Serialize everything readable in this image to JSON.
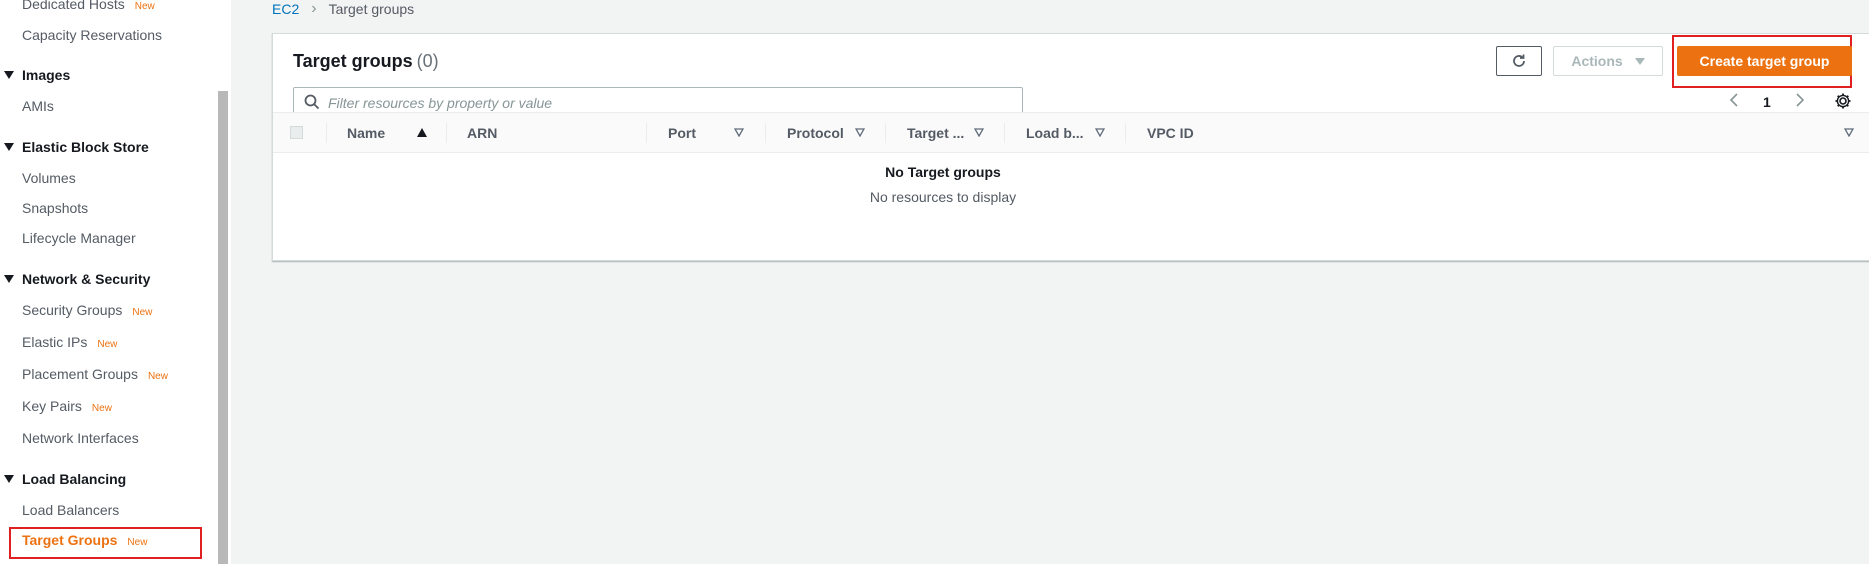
{
  "sidebar": {
    "items_top": [
      {
        "label": "Dedicated Hosts",
        "badge": "New"
      },
      {
        "label": "Capacity Reservations",
        "badge": ""
      }
    ],
    "sections": [
      {
        "title": "Images",
        "items": [
          {
            "label": "AMIs",
            "badge": ""
          }
        ]
      },
      {
        "title": "Elastic Block Store",
        "items": [
          {
            "label": "Volumes",
            "badge": ""
          },
          {
            "label": "Snapshots",
            "badge": ""
          },
          {
            "label": "Lifecycle Manager",
            "badge": ""
          }
        ]
      },
      {
        "title": "Network & Security",
        "items": [
          {
            "label": "Security Groups",
            "badge": "New"
          },
          {
            "label": "Elastic IPs",
            "badge": "New"
          },
          {
            "label": "Placement Groups",
            "badge": "New"
          },
          {
            "label": "Key Pairs",
            "badge": "New"
          },
          {
            "label": "Network Interfaces",
            "badge": ""
          }
        ]
      },
      {
        "title": "Load Balancing",
        "items": [
          {
            "label": "Load Balancers",
            "badge": ""
          },
          {
            "label": "Target Groups",
            "badge": "New"
          }
        ]
      }
    ]
  },
  "breadcrumb": {
    "root": "EC2",
    "current": "Target groups"
  },
  "panel": {
    "title": "Target groups",
    "count": "(0)",
    "actions_label": "Actions",
    "create_label": "Create target group",
    "search_placeholder": "Filter resources by property or value",
    "page": "1"
  },
  "table": {
    "columns": [
      "Name",
      "ARN",
      "Port",
      "Protocol",
      "Target ...",
      "Load b...",
      "VPC ID"
    ],
    "empty_title": "No Target groups",
    "empty_subtitle": "No resources to display"
  },
  "colors": {
    "accent": "#ec7211",
    "link": "#0073bb",
    "highlight_outline": "#e02020"
  }
}
